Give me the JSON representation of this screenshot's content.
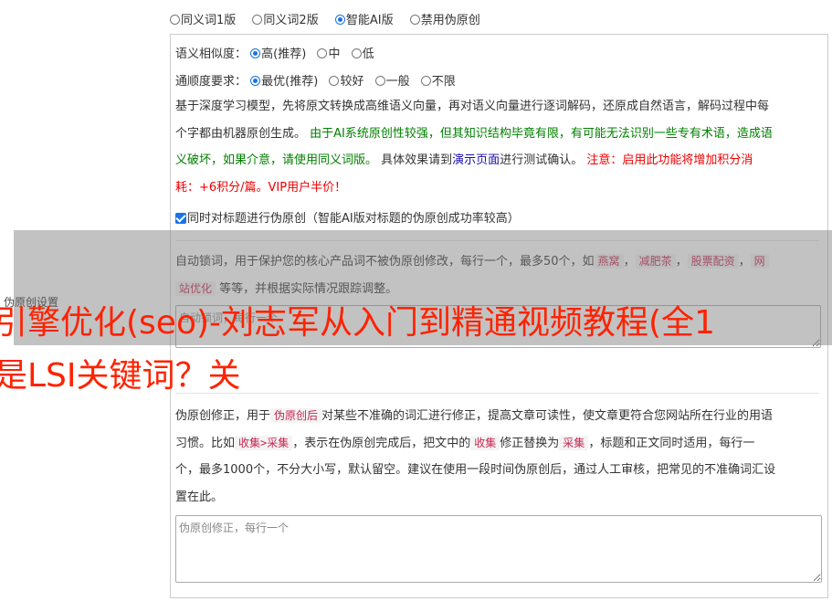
{
  "modes": {
    "options": [
      "同义词1版",
      "同义词2版",
      "智能AI版",
      "禁用伪原创"
    ],
    "selected": 2
  },
  "similarity": {
    "label": "语义相似度：",
    "options": [
      "高(推荐)",
      "中",
      "低"
    ],
    "selected": 0
  },
  "fluency": {
    "label": "通顺度要求：",
    "options": [
      "最优(推荐)",
      "较好",
      "一般",
      "不限"
    ],
    "selected": 0
  },
  "description": {
    "line1": "基于深度学习模型，先将原文转换成高维语义向量，再对语义向量进行逐词解码，还原成自然语言，解码过程中每",
    "line2_plain": "个字都由机器原创生成。",
    "line2_green": "由于AI系统原创性较强，但其知识结构毕竟有限，有可能无法识别一些专有术语，造成语",
    "line3_green": "义破坏，如果介意，请使用同义词版。",
    "line3_plain1": "具体效果请到",
    "line3_link": "演示页面",
    "line3_plain2": "进行测试确认。",
    "line3_red": "注意：启用此功能将增加积分消",
    "line4_red": "耗：+6积分/篇。VIP用户半价！"
  },
  "title_checkbox": {
    "checked": true,
    "label": "同时对标题进行伪原创（智能AI版对标题的伪原创成功率较高）"
  },
  "lock_words": {
    "text_a": "自动锁词，用于保护您的核心产品词不被伪原创修改，每行一个，最多50个，如",
    "examples": [
      "燕窝",
      "减肥茶",
      "股票配资",
      "网"
    ],
    "example_cont": "站优化",
    "text_b": "等等，并根据实际情况跟踪调整。",
    "placeholder": "自动锁词，每行一个"
  },
  "correction": {
    "text_a": "伪原创修正，用于",
    "tag_a": "伪原创后",
    "text_b": "对某些不准确的词汇进行修正，提高文章可读性，使文章更符合您网站所在行业的用语",
    "line2_a": "习惯。比如",
    "tag_b": "收集>采集",
    "line2_b": "，表示在伪原创完成后，把文中的",
    "tag_c": "收集",
    "line2_c": "修正替换为",
    "tag_d": "采集",
    "line2_d": "，标题和正文同时适用，每行一",
    "line3": "个，最多1000个，不分大小写，默认留空。建议在使用一段时间伪原创后，通过人工审核，把常见的不准确词汇设",
    "line4": "置在此。",
    "placeholder": "伪原创修正，每行一个"
  },
  "side_label": "伪原创设置",
  "headline": {
    "line1": "引擎优化(seo)-刘志军从入门到精通视频教程(全1",
    "line2": "是LSI关键词？关"
  }
}
